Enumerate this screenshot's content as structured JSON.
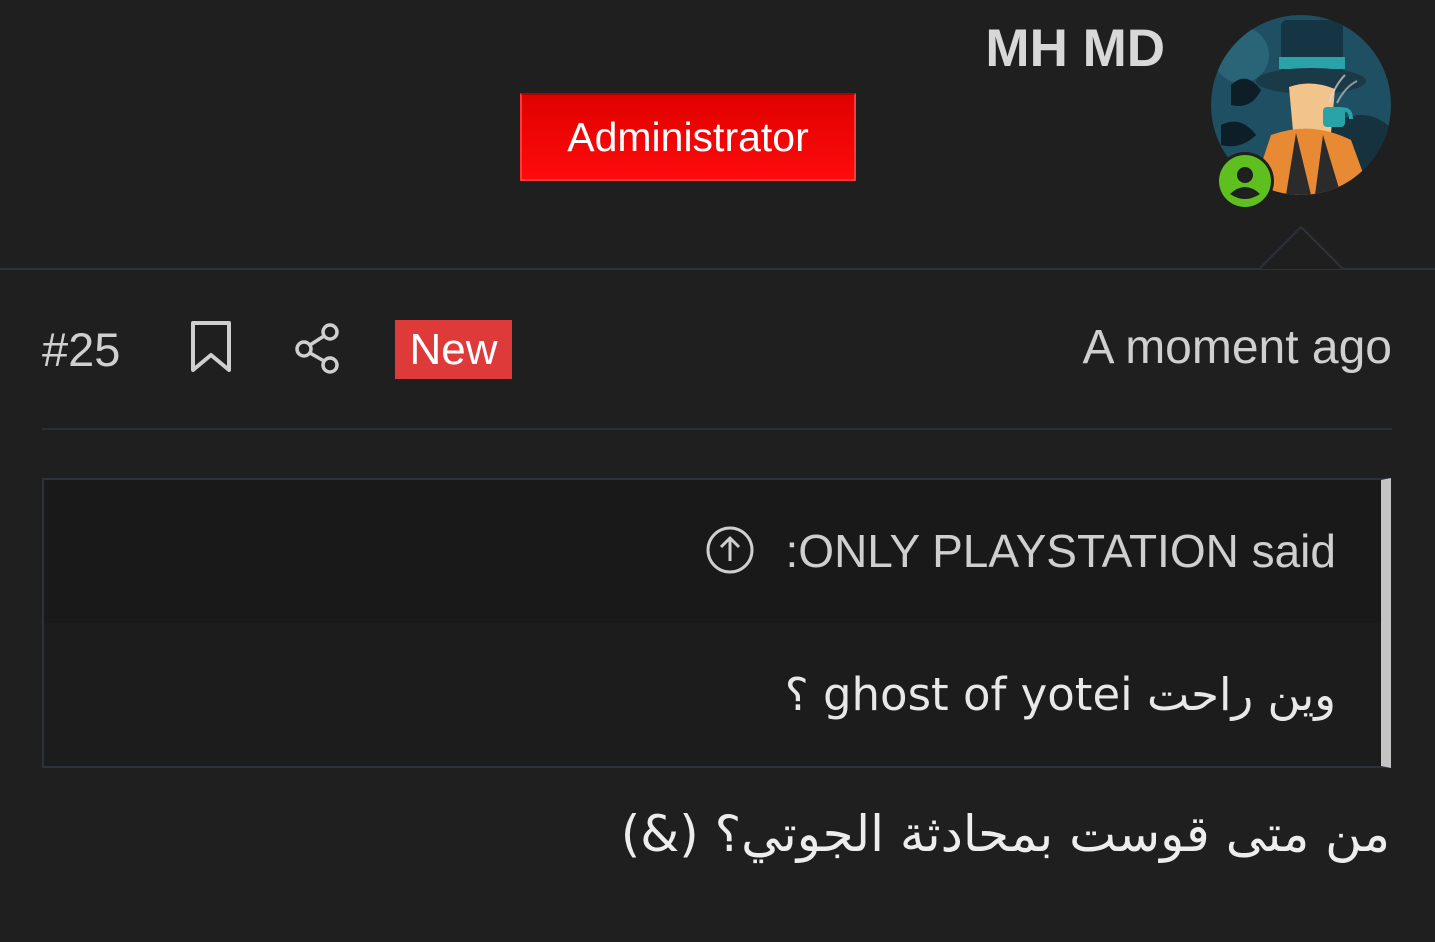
{
  "user": {
    "name": "MH MD",
    "role": "Administrator",
    "status": "online"
  },
  "post": {
    "number": "#25",
    "badge": "New",
    "timestamp": "A moment ago"
  },
  "quote": {
    "author_line": ":ONLY PLAYSTATION said",
    "text": "وين راحت ghost of yotei ؟"
  },
  "message": {
    "text": "من متى قوست بمحادثة الجوتي؟ (&)"
  },
  "colors": {
    "background": "#1f1f1f",
    "role_badge": "#ff0000",
    "new_badge": "#df3a3a",
    "online": "#5fbf1f",
    "quote_bar": "#c4c4c4"
  },
  "icons": {
    "bookmark": "bookmark-icon",
    "share": "share-icon",
    "jump": "arrow-up-circle-icon",
    "online": "user-online-icon"
  }
}
